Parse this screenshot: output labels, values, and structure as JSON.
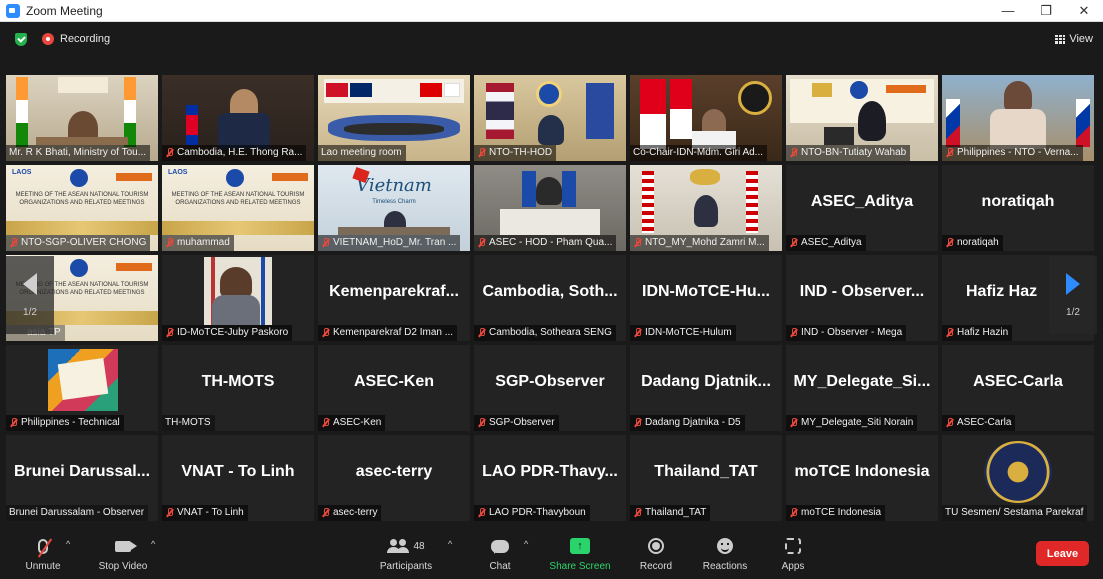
{
  "window": {
    "title": "Zoom Meeting",
    "minimize": "—",
    "restore": "❐",
    "close": "✕"
  },
  "meeting": {
    "recording_label": "Recording",
    "view_label": "View"
  },
  "pager": {
    "left": "1/2",
    "right": "1/2"
  },
  "tiles": [
    {
      "label": "Mr. R K Bhati, Ministry of Tou...",
      "muted": false,
      "big": ""
    },
    {
      "label": "Cambodia, H.E. Thong Ra...",
      "muted": true,
      "big": ""
    },
    {
      "label": "Lao meeting room",
      "muted": false,
      "big": ""
    },
    {
      "label": "NTO-TH-HOD",
      "muted": true,
      "big": ""
    },
    {
      "label": "Co-Chair-IDN-Mdm. Giri Ad...",
      "muted": false,
      "big": ""
    },
    {
      "label": "NTO-BN-Tutiaty Wahab",
      "muted": true,
      "big": ""
    },
    {
      "label": "Philippines - NTO - Verna...",
      "muted": true,
      "big": ""
    },
    {
      "label": "NTO-SGP-OLIVER CHONG",
      "muted": true,
      "big": ""
    },
    {
      "label": "muhammad",
      "muted": true,
      "big": ""
    },
    {
      "label": "VIETNAM_HoD_Mr. Tran ...",
      "muted": true,
      "big": ""
    },
    {
      "label": "ASEC - HOD - Pham Qua...",
      "muted": true,
      "big": ""
    },
    {
      "label": "NTO_MY_Mohd Zamri M...",
      "muted": true,
      "big": ""
    },
    {
      "label": "ASEC_Aditya",
      "muted": true,
      "big": "ASEC_Aditya"
    },
    {
      "label": "noratiqah",
      "muted": true,
      "big": "noratiqah"
    },
    {
      "label": "asia TP",
      "muted": false,
      "big": ""
    },
    {
      "label": "ID-MoTCE-Juby Paskoro",
      "muted": true,
      "big": ""
    },
    {
      "label": "Kemenparekraf D2 Iman ...",
      "muted": true,
      "big": "Kemenparekraf..."
    },
    {
      "label": "Cambodia, Sotheara SENG",
      "muted": true,
      "big": "Cambodia, Soth..."
    },
    {
      "label": "IDN-MoTCE-Hulum",
      "muted": true,
      "big": "IDN-MoTCE-Hu..."
    },
    {
      "label": "IND - Observer - Mega",
      "muted": true,
      "big": "IND - Observer..."
    },
    {
      "label": "Hafiz Hazin",
      "muted": true,
      "big": "Hafiz Haz"
    },
    {
      "label": "Philippines - Technical",
      "muted": true,
      "big": ""
    },
    {
      "label": "TH-MOTS",
      "muted": false,
      "big": "TH-MOTS"
    },
    {
      "label": "ASEC-Ken",
      "muted": true,
      "big": "ASEC-Ken"
    },
    {
      "label": "SGP-Observer",
      "muted": true,
      "big": "SGP-Observer"
    },
    {
      "label": "Dadang Djatnika - D5",
      "muted": true,
      "big": "Dadang Djatnik..."
    },
    {
      "label": "MY_Delegate_Siti Norain",
      "muted": true,
      "big": "MY_Delegate_Si..."
    },
    {
      "label": "ASEC-Carla",
      "muted": true,
      "big": "ASEC-Carla"
    },
    {
      "label": "Brunei Darussalam - Observer",
      "muted": false,
      "big": "Brunei Darussal..."
    },
    {
      "label": "VNAT - To Linh",
      "muted": true,
      "big": "VNAT - To Linh"
    },
    {
      "label": "asec-terry",
      "muted": true,
      "big": "asec-terry"
    },
    {
      "label": "LAO PDR-Thavyboun",
      "muted": true,
      "big": "LAO PDR-Thavy..."
    },
    {
      "label": "Thailand_TAT",
      "muted": true,
      "big": "Thailand_TAT"
    },
    {
      "label": "moTCE Indonesia",
      "muted": true,
      "big": "moTCE Indonesia"
    },
    {
      "label": "TU Sesmen/ Sestama Parekraf",
      "muted": false,
      "big": ""
    }
  ],
  "scene_text": {
    "lao_banner": "LAOS",
    "asean_meeting": "MEETING OF THE ASEAN NATIONAL TOURISM ORGANIZATIONS AND RELATED MEETINGS",
    "vietnam_main": "Vietnam",
    "vietnam_sub": "Timeless Charm"
  },
  "toolbar": {
    "unmute": "Unmute",
    "stop_video": "Stop Video",
    "participants_count": "48",
    "participants": "Participants",
    "chat": "Chat",
    "share_screen": "Share Screen",
    "record": "Record",
    "reactions": "Reactions",
    "apps": "Apps",
    "leave": "Leave",
    "caret": "^"
  },
  "colors": {
    "active_speaker": "#f3e83a",
    "leave": "#e02828",
    "share": "#2bd46a",
    "accent": "#2d8cff",
    "muted": "#e8483c"
  }
}
